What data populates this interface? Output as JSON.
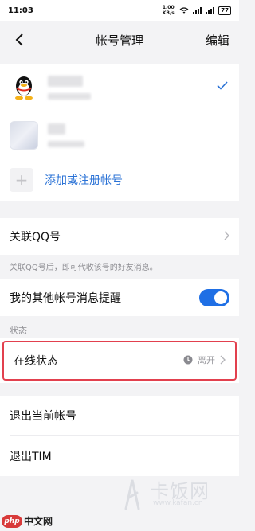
{
  "status_bar": {
    "time": "11:03",
    "network": "1.00 KB/s",
    "battery": "77"
  },
  "nav": {
    "title": "帐号管理",
    "edit_label": "编辑"
  },
  "accounts": {
    "add_label": "添加或注册帐号"
  },
  "settings": {
    "link_qq": "关联QQ号",
    "link_hint": "关联QQ号后，即可代收该号的好友消息。",
    "other_notify": "我的其他帐号消息提醒",
    "other_notify_on": true,
    "section_status": "状态",
    "online_status": "在线状态",
    "online_status_value": "离开",
    "logout_current": "退出当前帐号",
    "exit_app": "退出TIM"
  },
  "watermark": {
    "brand": "卡饭网",
    "url": "www.kafan.cn"
  },
  "logo": {
    "php": "php",
    "text": "中文网"
  },
  "colors": {
    "accent": "#2a72d6",
    "toggle": "#1f6fe5",
    "highlight": "#e2404e"
  }
}
